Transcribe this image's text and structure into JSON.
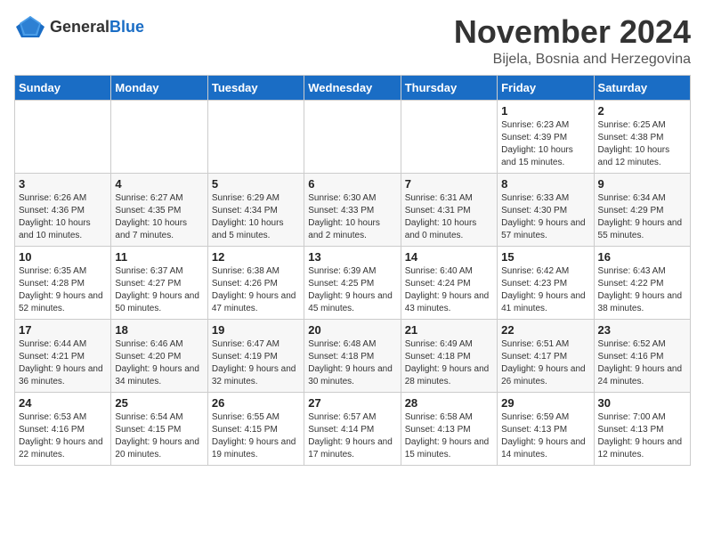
{
  "header": {
    "logo": {
      "text_general": "General",
      "text_blue": "Blue"
    },
    "title": "November 2024",
    "subtitle": "Bijela, Bosnia and Herzegovina"
  },
  "weekdays": [
    "Sunday",
    "Monday",
    "Tuesday",
    "Wednesday",
    "Thursday",
    "Friday",
    "Saturday"
  ],
  "weeks": [
    [
      {
        "day": "",
        "info": ""
      },
      {
        "day": "",
        "info": ""
      },
      {
        "day": "",
        "info": ""
      },
      {
        "day": "",
        "info": ""
      },
      {
        "day": "",
        "info": ""
      },
      {
        "day": "1",
        "info": "Sunrise: 6:23 AM\nSunset: 4:39 PM\nDaylight: 10 hours and 15 minutes."
      },
      {
        "day": "2",
        "info": "Sunrise: 6:25 AM\nSunset: 4:38 PM\nDaylight: 10 hours and 12 minutes."
      }
    ],
    [
      {
        "day": "3",
        "info": "Sunrise: 6:26 AM\nSunset: 4:36 PM\nDaylight: 10 hours and 10 minutes."
      },
      {
        "day": "4",
        "info": "Sunrise: 6:27 AM\nSunset: 4:35 PM\nDaylight: 10 hours and 7 minutes."
      },
      {
        "day": "5",
        "info": "Sunrise: 6:29 AM\nSunset: 4:34 PM\nDaylight: 10 hours and 5 minutes."
      },
      {
        "day": "6",
        "info": "Sunrise: 6:30 AM\nSunset: 4:33 PM\nDaylight: 10 hours and 2 minutes."
      },
      {
        "day": "7",
        "info": "Sunrise: 6:31 AM\nSunset: 4:31 PM\nDaylight: 10 hours and 0 minutes."
      },
      {
        "day": "8",
        "info": "Sunrise: 6:33 AM\nSunset: 4:30 PM\nDaylight: 9 hours and 57 minutes."
      },
      {
        "day": "9",
        "info": "Sunrise: 6:34 AM\nSunset: 4:29 PM\nDaylight: 9 hours and 55 minutes."
      }
    ],
    [
      {
        "day": "10",
        "info": "Sunrise: 6:35 AM\nSunset: 4:28 PM\nDaylight: 9 hours and 52 minutes."
      },
      {
        "day": "11",
        "info": "Sunrise: 6:37 AM\nSunset: 4:27 PM\nDaylight: 9 hours and 50 minutes."
      },
      {
        "day": "12",
        "info": "Sunrise: 6:38 AM\nSunset: 4:26 PM\nDaylight: 9 hours and 47 minutes."
      },
      {
        "day": "13",
        "info": "Sunrise: 6:39 AM\nSunset: 4:25 PM\nDaylight: 9 hours and 45 minutes."
      },
      {
        "day": "14",
        "info": "Sunrise: 6:40 AM\nSunset: 4:24 PM\nDaylight: 9 hours and 43 minutes."
      },
      {
        "day": "15",
        "info": "Sunrise: 6:42 AM\nSunset: 4:23 PM\nDaylight: 9 hours and 41 minutes."
      },
      {
        "day": "16",
        "info": "Sunrise: 6:43 AM\nSunset: 4:22 PM\nDaylight: 9 hours and 38 minutes."
      }
    ],
    [
      {
        "day": "17",
        "info": "Sunrise: 6:44 AM\nSunset: 4:21 PM\nDaylight: 9 hours and 36 minutes."
      },
      {
        "day": "18",
        "info": "Sunrise: 6:46 AM\nSunset: 4:20 PM\nDaylight: 9 hours and 34 minutes."
      },
      {
        "day": "19",
        "info": "Sunrise: 6:47 AM\nSunset: 4:19 PM\nDaylight: 9 hours and 32 minutes."
      },
      {
        "day": "20",
        "info": "Sunrise: 6:48 AM\nSunset: 4:18 PM\nDaylight: 9 hours and 30 minutes."
      },
      {
        "day": "21",
        "info": "Sunrise: 6:49 AM\nSunset: 4:18 PM\nDaylight: 9 hours and 28 minutes."
      },
      {
        "day": "22",
        "info": "Sunrise: 6:51 AM\nSunset: 4:17 PM\nDaylight: 9 hours and 26 minutes."
      },
      {
        "day": "23",
        "info": "Sunrise: 6:52 AM\nSunset: 4:16 PM\nDaylight: 9 hours and 24 minutes."
      }
    ],
    [
      {
        "day": "24",
        "info": "Sunrise: 6:53 AM\nSunset: 4:16 PM\nDaylight: 9 hours and 22 minutes."
      },
      {
        "day": "25",
        "info": "Sunrise: 6:54 AM\nSunset: 4:15 PM\nDaylight: 9 hours and 20 minutes."
      },
      {
        "day": "26",
        "info": "Sunrise: 6:55 AM\nSunset: 4:15 PM\nDaylight: 9 hours and 19 minutes."
      },
      {
        "day": "27",
        "info": "Sunrise: 6:57 AM\nSunset: 4:14 PM\nDaylight: 9 hours and 17 minutes."
      },
      {
        "day": "28",
        "info": "Sunrise: 6:58 AM\nSunset: 4:13 PM\nDaylight: 9 hours and 15 minutes."
      },
      {
        "day": "29",
        "info": "Sunrise: 6:59 AM\nSunset: 4:13 PM\nDaylight: 9 hours and 14 minutes."
      },
      {
        "day": "30",
        "info": "Sunrise: 7:00 AM\nSunset: 4:13 PM\nDaylight: 9 hours and 12 minutes."
      }
    ]
  ]
}
